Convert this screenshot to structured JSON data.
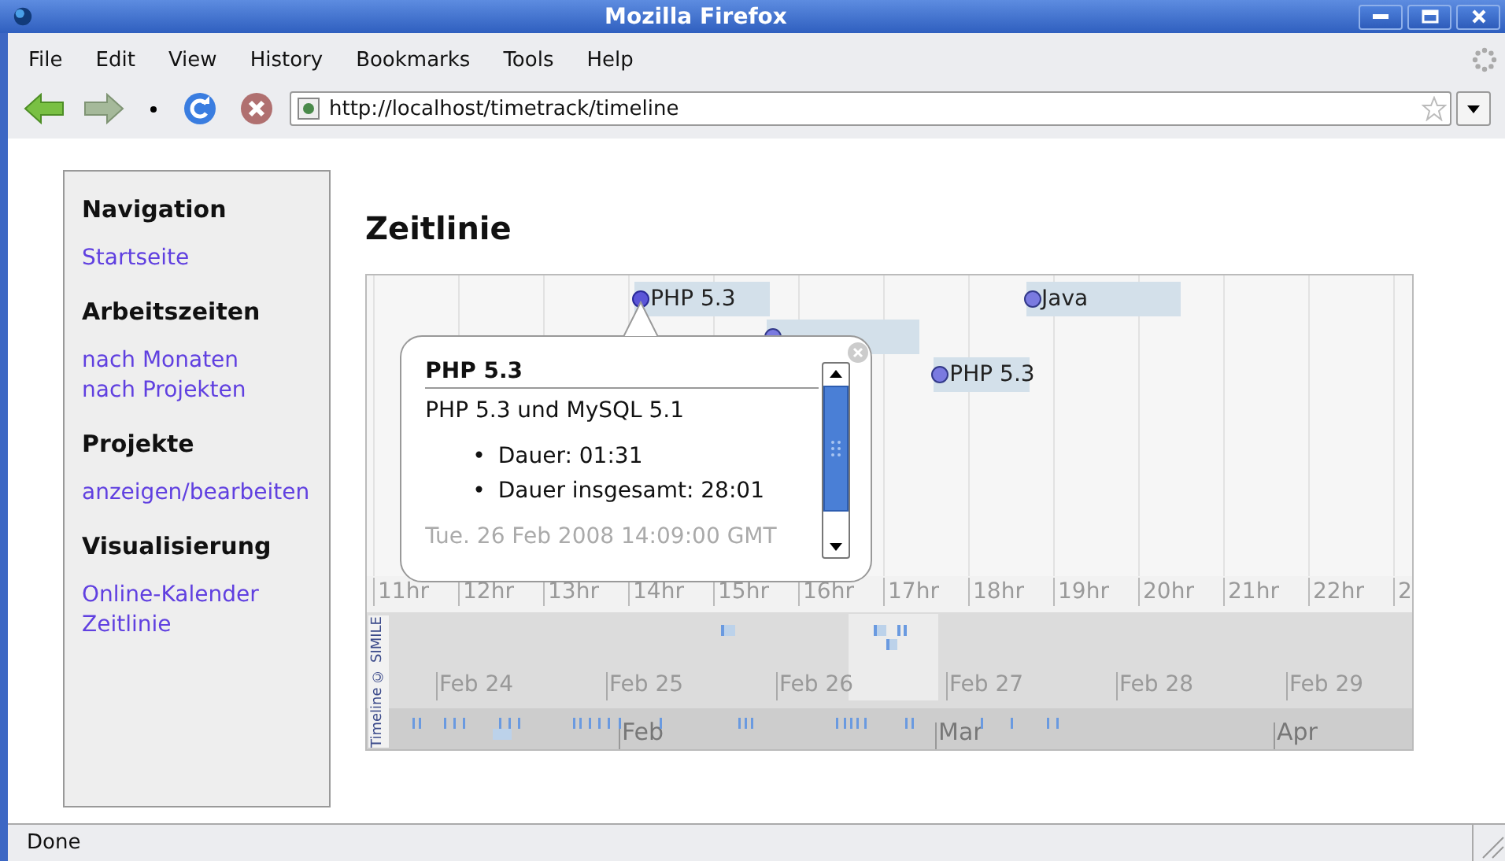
{
  "window": {
    "title": "Mozilla Firefox"
  },
  "menu": [
    {
      "label": "File"
    },
    {
      "label": "Edit"
    },
    {
      "label": "View"
    },
    {
      "label": "History"
    },
    {
      "label": "Bookmarks"
    },
    {
      "label": "Tools"
    },
    {
      "label": "Help"
    }
  ],
  "navigation_bar": {
    "url": "http://localhost/timetrack/timeline"
  },
  "sidebar": [
    {
      "heading": "Navigation",
      "links": [
        "Startseite"
      ]
    },
    {
      "heading": "Arbeitszeiten",
      "links": [
        "nach Monaten",
        "nach Projekten"
      ]
    },
    {
      "heading": "Projekte",
      "links": [
        "anzeigen/bearbeiten"
      ]
    },
    {
      "heading": "Visualisierung",
      "links": [
        "Online-Kalender",
        "Zeitlinie"
      ]
    }
  ],
  "page_title": "Zeitlinie",
  "timeline": {
    "tracks": [
      [
        {
          "label": "PHP 5.3",
          "selected": true
        },
        {
          "label": "Java",
          "selected": false
        }
      ],
      [
        {
          "selected": false
        }
      ],
      [
        {
          "label": "PHP 5.3",
          "selected": false
        }
      ]
    ],
    "bubble": {
      "title": "PHP 5.3",
      "description": "PHP 5.3 und MySQL 5.1",
      "details": [
        {
          "bullet": "•",
          "text": "Dauer: 01:31"
        },
        {
          "bullet": "•",
          "text": "Dauer insgesamt: 28:01"
        }
      ],
      "date": "Tue. 26 Feb 2008 14:09:00 GMT"
    },
    "hours": [
      "11hr",
      "12hr",
      "13hr",
      "14hr",
      "15hr",
      "16hr",
      "17hr",
      "18hr",
      "19hr",
      "20hr",
      "21hr",
      "22hr",
      "2"
    ],
    "days": [
      "Feb 24",
      "Feb 25",
      "Feb 26",
      "Feb 27",
      "Feb 28",
      "Feb 29"
    ],
    "months": [
      "Feb",
      "Mar",
      "Apr"
    ],
    "credit": "Timeline © SIMILE"
  },
  "status_bar": "Done"
}
